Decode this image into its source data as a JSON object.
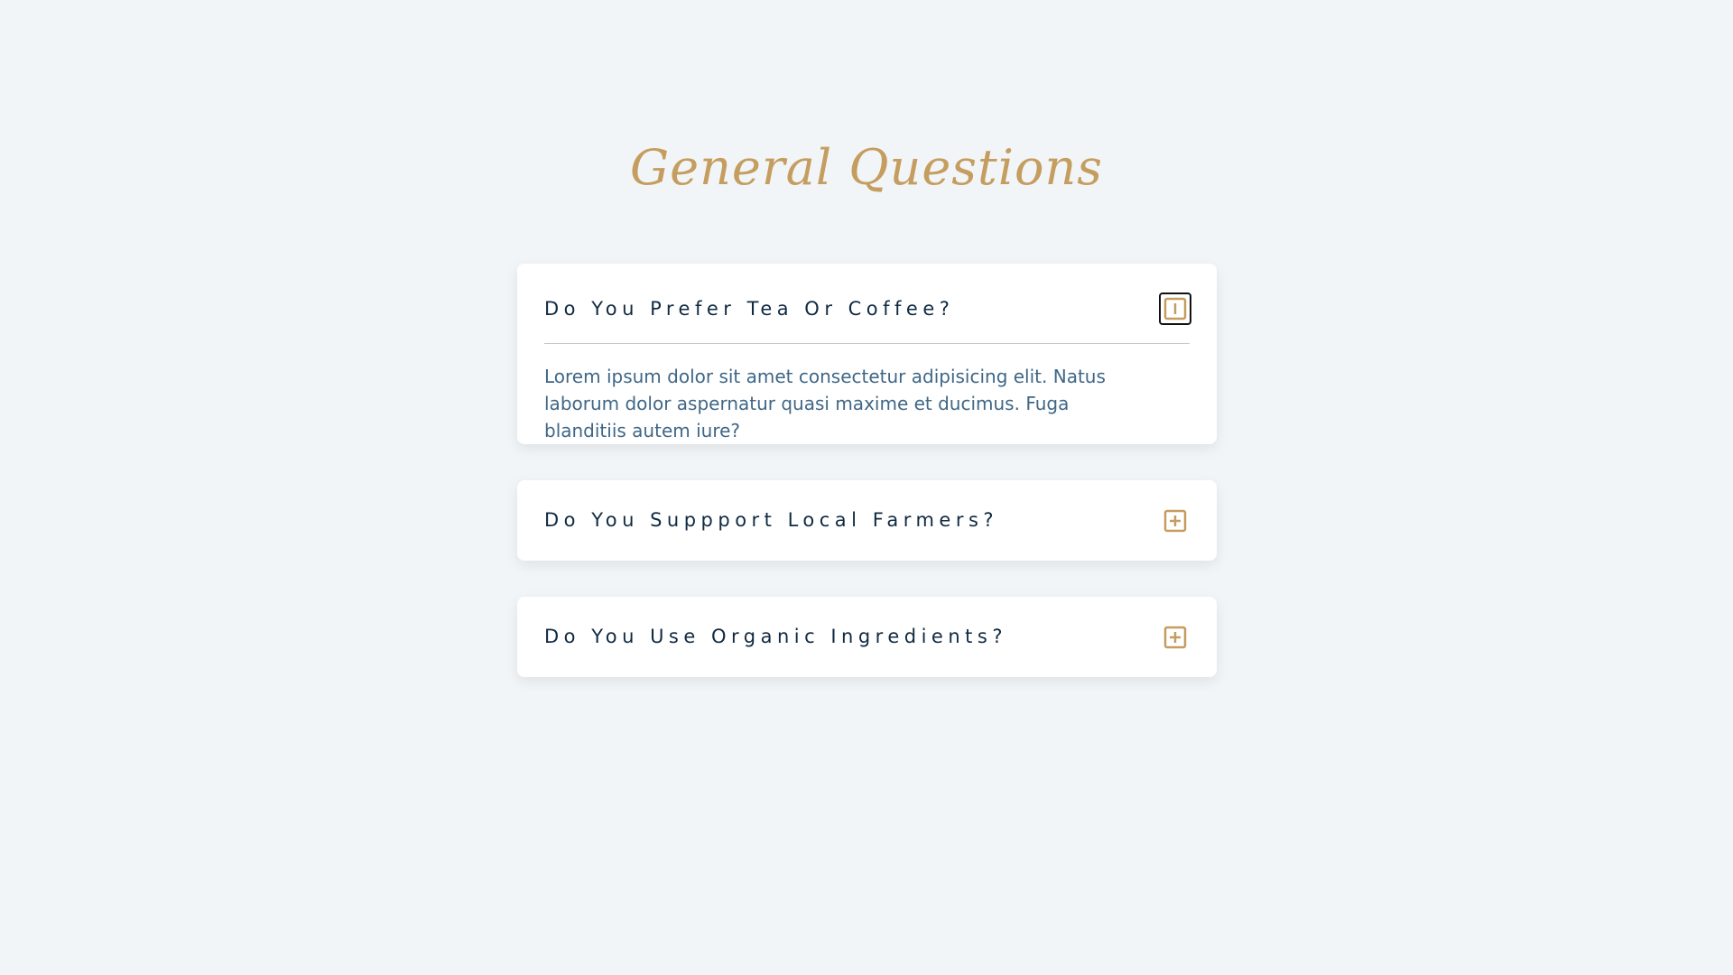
{
  "page": {
    "title": "General Questions"
  },
  "colors": {
    "background": "#f1f5f8",
    "accent": "#c59d5f",
    "question_text": "#102a42",
    "answer_text": "#3f6787",
    "card": "#ffffff"
  },
  "faqs": [
    {
      "question": "Do You Prefer Tea Or Coffee?",
      "answer": "Lorem ipsum dolor sit amet consectetur adipisicing elit. Natus laborum dolor aspernatur quasi maxime et ducimus. Fuga blanditiis autem iure?",
      "expanded": true,
      "toggle_icon": "minus-square-icon"
    },
    {
      "question": "Do You Suppport Local Farmers?",
      "expanded": false,
      "toggle_icon": "plus-square-icon"
    },
    {
      "question": "Do You Use Organic Ingredients?",
      "expanded": false,
      "toggle_icon": "plus-square-icon"
    }
  ]
}
